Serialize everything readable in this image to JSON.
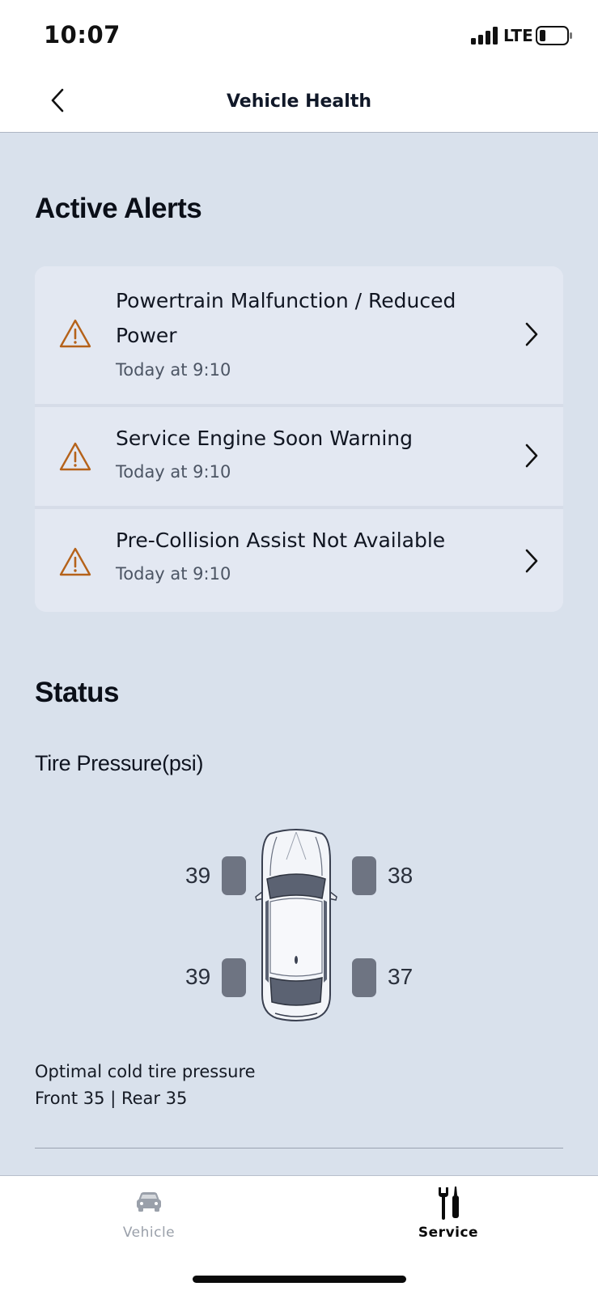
{
  "status_bar": {
    "time": "10:07",
    "network": "LTE"
  },
  "nav": {
    "title": "Vehicle Health",
    "back_icon": "chevron-left-icon"
  },
  "alerts": {
    "heading": "Active Alerts",
    "items": [
      {
        "title": "Powertrain Malfunction / Reduced Power",
        "time": "Today at 9:10",
        "icon": "warning-icon"
      },
      {
        "title": "Service Engine Soon Warning",
        "time": "Today at 9:10",
        "icon": "warning-icon"
      },
      {
        "title": "Pre-Collision Assist Not Available",
        "time": "Today at 9:10",
        "icon": "warning-icon"
      }
    ],
    "warning_color": "#b5621a"
  },
  "status": {
    "heading": "Status",
    "tire_pressure": {
      "title": "Tire Pressure(psi)",
      "front_left": "39",
      "front_right": "38",
      "rear_left": "39",
      "rear_right": "37",
      "optimal_label": "Optimal cold tire pressure",
      "optimal_values": "Front 35 | Rear 35"
    }
  },
  "tab_bar": {
    "tabs": [
      {
        "label": "Vehicle",
        "icon": "car-icon",
        "active": false
      },
      {
        "label": "Service",
        "icon": "tools-icon",
        "active": true
      }
    ],
    "active_color": "#0a0a0a",
    "inactive_color": "#9aa0aa"
  }
}
